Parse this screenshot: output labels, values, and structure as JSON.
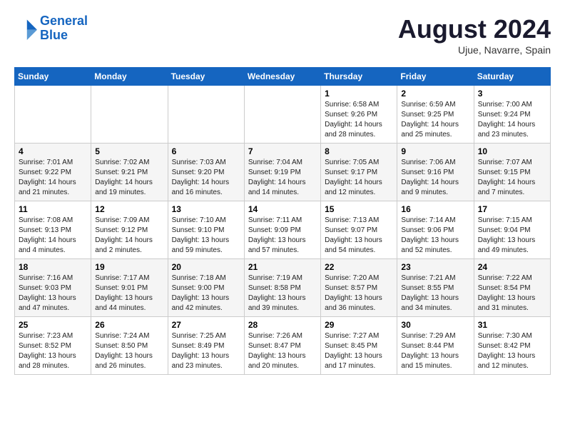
{
  "header": {
    "logo_line1": "General",
    "logo_line2": "Blue",
    "month_title": "August 2024",
    "location": "Ujue, Navarre, Spain"
  },
  "weekdays": [
    "Sunday",
    "Monday",
    "Tuesday",
    "Wednesday",
    "Thursday",
    "Friday",
    "Saturday"
  ],
  "weeks": [
    [
      {
        "day": "",
        "info": ""
      },
      {
        "day": "",
        "info": ""
      },
      {
        "day": "",
        "info": ""
      },
      {
        "day": "",
        "info": ""
      },
      {
        "day": "1",
        "info": "Sunrise: 6:58 AM\nSunset: 9:26 PM\nDaylight: 14 hours\nand 28 minutes."
      },
      {
        "day": "2",
        "info": "Sunrise: 6:59 AM\nSunset: 9:25 PM\nDaylight: 14 hours\nand 25 minutes."
      },
      {
        "day": "3",
        "info": "Sunrise: 7:00 AM\nSunset: 9:24 PM\nDaylight: 14 hours\nand 23 minutes."
      }
    ],
    [
      {
        "day": "4",
        "info": "Sunrise: 7:01 AM\nSunset: 9:22 PM\nDaylight: 14 hours\nand 21 minutes."
      },
      {
        "day": "5",
        "info": "Sunrise: 7:02 AM\nSunset: 9:21 PM\nDaylight: 14 hours\nand 19 minutes."
      },
      {
        "day": "6",
        "info": "Sunrise: 7:03 AM\nSunset: 9:20 PM\nDaylight: 14 hours\nand 16 minutes."
      },
      {
        "day": "7",
        "info": "Sunrise: 7:04 AM\nSunset: 9:19 PM\nDaylight: 14 hours\nand 14 minutes."
      },
      {
        "day": "8",
        "info": "Sunrise: 7:05 AM\nSunset: 9:17 PM\nDaylight: 14 hours\nand 12 minutes."
      },
      {
        "day": "9",
        "info": "Sunrise: 7:06 AM\nSunset: 9:16 PM\nDaylight: 14 hours\nand 9 minutes."
      },
      {
        "day": "10",
        "info": "Sunrise: 7:07 AM\nSunset: 9:15 PM\nDaylight: 14 hours\nand 7 minutes."
      }
    ],
    [
      {
        "day": "11",
        "info": "Sunrise: 7:08 AM\nSunset: 9:13 PM\nDaylight: 14 hours\nand 4 minutes."
      },
      {
        "day": "12",
        "info": "Sunrise: 7:09 AM\nSunset: 9:12 PM\nDaylight: 14 hours\nand 2 minutes."
      },
      {
        "day": "13",
        "info": "Sunrise: 7:10 AM\nSunset: 9:10 PM\nDaylight: 13 hours\nand 59 minutes."
      },
      {
        "day": "14",
        "info": "Sunrise: 7:11 AM\nSunset: 9:09 PM\nDaylight: 13 hours\nand 57 minutes."
      },
      {
        "day": "15",
        "info": "Sunrise: 7:13 AM\nSunset: 9:07 PM\nDaylight: 13 hours\nand 54 minutes."
      },
      {
        "day": "16",
        "info": "Sunrise: 7:14 AM\nSunset: 9:06 PM\nDaylight: 13 hours\nand 52 minutes."
      },
      {
        "day": "17",
        "info": "Sunrise: 7:15 AM\nSunset: 9:04 PM\nDaylight: 13 hours\nand 49 minutes."
      }
    ],
    [
      {
        "day": "18",
        "info": "Sunrise: 7:16 AM\nSunset: 9:03 PM\nDaylight: 13 hours\nand 47 minutes."
      },
      {
        "day": "19",
        "info": "Sunrise: 7:17 AM\nSunset: 9:01 PM\nDaylight: 13 hours\nand 44 minutes."
      },
      {
        "day": "20",
        "info": "Sunrise: 7:18 AM\nSunset: 9:00 PM\nDaylight: 13 hours\nand 42 minutes."
      },
      {
        "day": "21",
        "info": "Sunrise: 7:19 AM\nSunset: 8:58 PM\nDaylight: 13 hours\nand 39 minutes."
      },
      {
        "day": "22",
        "info": "Sunrise: 7:20 AM\nSunset: 8:57 PM\nDaylight: 13 hours\nand 36 minutes."
      },
      {
        "day": "23",
        "info": "Sunrise: 7:21 AM\nSunset: 8:55 PM\nDaylight: 13 hours\nand 34 minutes."
      },
      {
        "day": "24",
        "info": "Sunrise: 7:22 AM\nSunset: 8:54 PM\nDaylight: 13 hours\nand 31 minutes."
      }
    ],
    [
      {
        "day": "25",
        "info": "Sunrise: 7:23 AM\nSunset: 8:52 PM\nDaylight: 13 hours\nand 28 minutes."
      },
      {
        "day": "26",
        "info": "Sunrise: 7:24 AM\nSunset: 8:50 PM\nDaylight: 13 hours\nand 26 minutes."
      },
      {
        "day": "27",
        "info": "Sunrise: 7:25 AM\nSunset: 8:49 PM\nDaylight: 13 hours\nand 23 minutes."
      },
      {
        "day": "28",
        "info": "Sunrise: 7:26 AM\nSunset: 8:47 PM\nDaylight: 13 hours\nand 20 minutes."
      },
      {
        "day": "29",
        "info": "Sunrise: 7:27 AM\nSunset: 8:45 PM\nDaylight: 13 hours\nand 17 minutes."
      },
      {
        "day": "30",
        "info": "Sunrise: 7:29 AM\nSunset: 8:44 PM\nDaylight: 13 hours\nand 15 minutes."
      },
      {
        "day": "31",
        "info": "Sunrise: 7:30 AM\nSunset: 8:42 PM\nDaylight: 13 hours\nand 12 minutes."
      }
    ]
  ]
}
